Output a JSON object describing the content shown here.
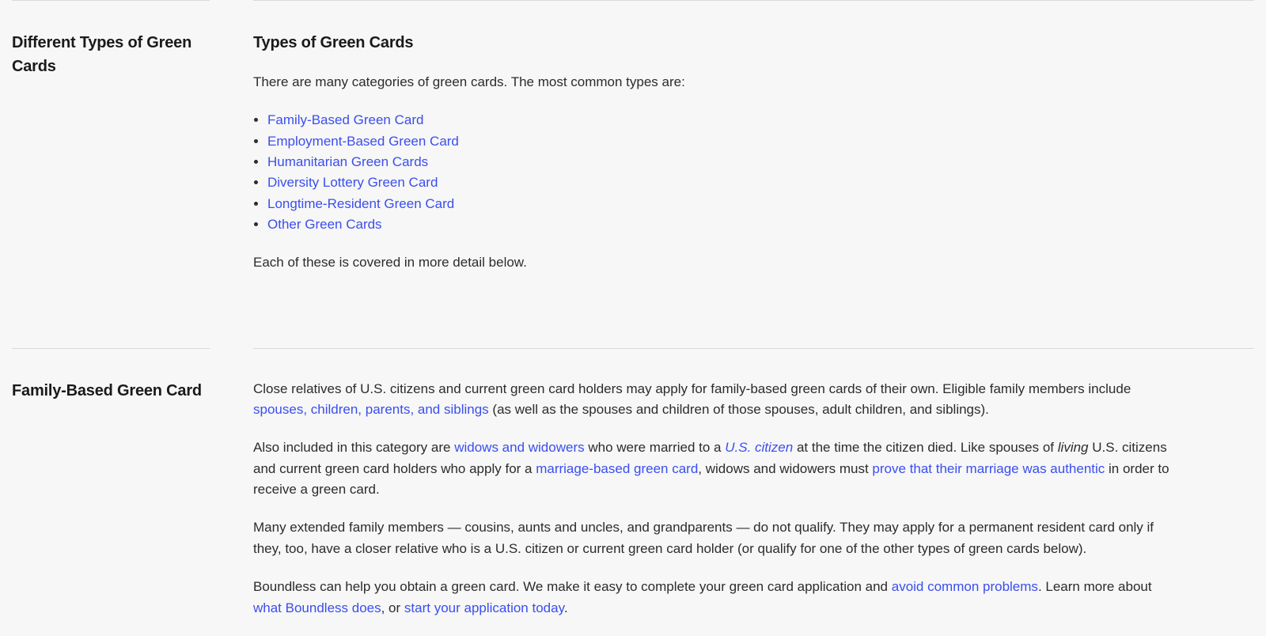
{
  "s1": {
    "side_heading": "Different Types of Green Cards",
    "heading": "Types of Green Cards",
    "intro": "There are many categories of green cards. The most common types are:",
    "links": {
      "l0": "Family-Based Green Card",
      "l1": "Employment-Based Green Card",
      "l2": "Humanitarian Green Cards",
      "l3": "Diversity Lottery Green Card",
      "l4": "Longtime-Resident Green Card",
      "l5": "Other Green Cards"
    },
    "outro": "Each of these is covered in more detail below."
  },
  "s2": {
    "side_heading": "Family-Based Green Card",
    "p1": {
      "t0": "Close relatives of U.S. citizens and current green card holders may apply for family-based green cards of their own. Eligible family members include ",
      "link0": "spouses, children, parents, and siblings",
      "t1": " (as well as the spouses and children of those spouses, adult children, and siblings)."
    },
    "p2": {
      "t0": "Also included in this category are ",
      "link0": "widows and widowers",
      "t1": " who were married to a ",
      "em0": "U.S. citizen",
      "t2": " at the time the citizen died. Like spouses of ",
      "em1": "living",
      "t3": " U.S. citizens and current green card holders who apply for a ",
      "link1": "marriage-based green card",
      "t4": ", widows and widowers must ",
      "link2": "prove that their marriage was authentic",
      "t5": " in order to receive a green card."
    },
    "p3": "Many extended family members — cousins, aunts and uncles, and grandparents — do not qualify. They may apply for a permanent resident card only if they, too, have a closer relative who is a U.S. citizen or current green card holder (or qualify for one of the other types of green cards below).",
    "p4": {
      "t0": "Boundless can help you obtain a green card. We make it easy to complete your green card application and ",
      "link0": "avoid common problems",
      "t1": ". Learn more about ",
      "link1": "what Boundless does",
      "t2": ", or ",
      "link2": "start your application today",
      "t3": "."
    }
  }
}
